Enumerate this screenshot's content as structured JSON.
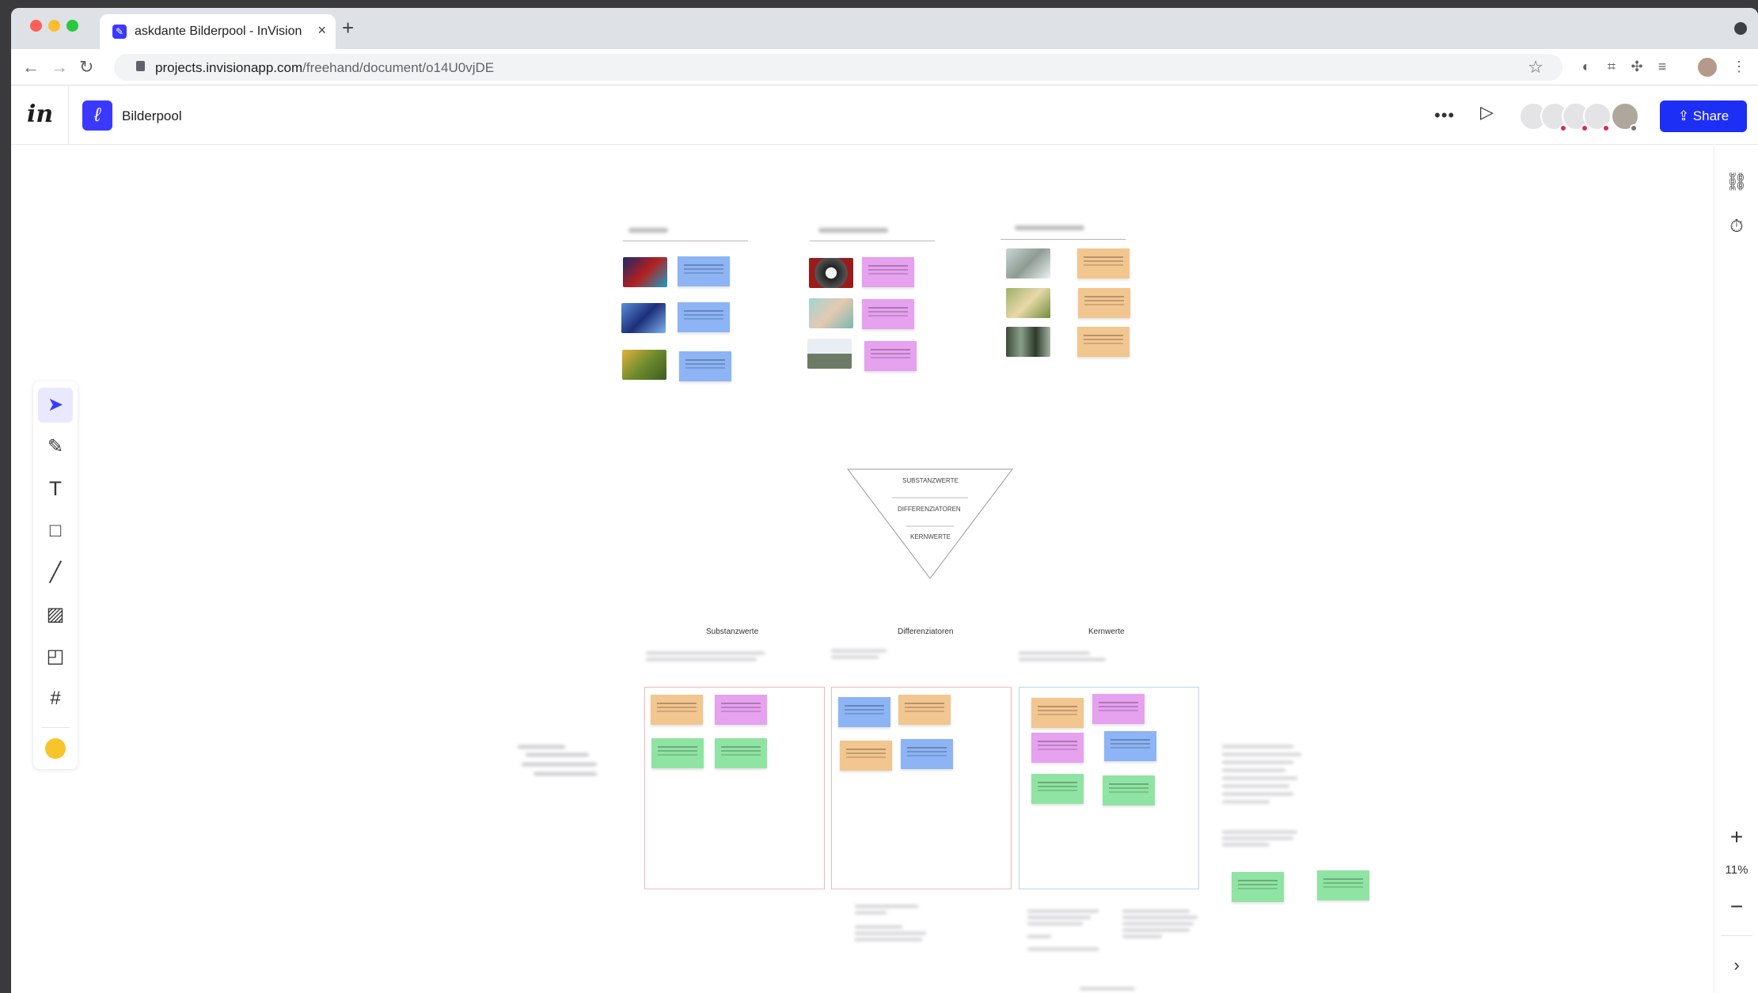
{
  "browser": {
    "tab_title": "askdante Bilderpool - InVision",
    "url_host": "projects.invisionapp.com",
    "url_path": "/freehand/document/o14U0vjDE"
  },
  "app": {
    "logo": "in",
    "document_title": "Bilderpool",
    "share_label": "Share",
    "zoom_level": "11%"
  },
  "canvas": {
    "diagram": {
      "tier1": "SUBSTANZWERTE",
      "tier2": "DIFFERENZIATOREN",
      "tier3": "KERNWERTE"
    },
    "columns": [
      {
        "title": "Substanzwerte"
      },
      {
        "title": "Differenziatoren"
      },
      {
        "title": "Kernwerte"
      }
    ]
  },
  "tools": [
    "select-tool",
    "pencil-tool",
    "text-tool",
    "rectangle-tool",
    "line-tool",
    "image-tool",
    "sticky-note-tool",
    "frame-tool",
    "emoji-tool"
  ],
  "colors": {
    "brand": "#1d2ef5",
    "accent": "#3b39ff",
    "sticky_blue": "#8db4f5",
    "sticky_pink": "#e6a1ef",
    "sticky_orange": "#f2c68f",
    "sticky_green": "#8fe4a3"
  }
}
